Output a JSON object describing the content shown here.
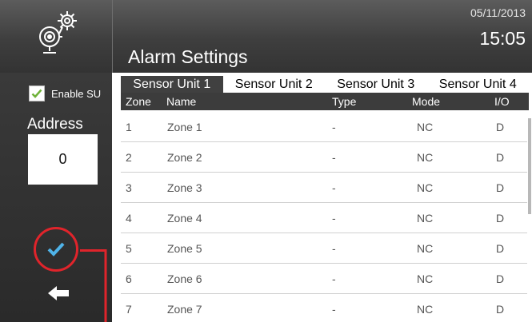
{
  "header": {
    "title": "Alarm Settings",
    "date": "05/11/2013",
    "time": "15:05",
    "logo_icon": "alarm-bell-gear-icon"
  },
  "sidebar": {
    "enable_label": "Enable SU",
    "enable_checked": true,
    "address_label": "Address",
    "address_value": "0",
    "confirm_icon": "checkmark-icon",
    "back_icon": "arrow-left-icon"
  },
  "tabs": [
    {
      "label": "Sensor Unit 1",
      "active": true
    },
    {
      "label": "Sensor Unit 2",
      "active": false
    },
    {
      "label": "Sensor Unit 3",
      "active": false
    },
    {
      "label": "Sensor Unit 4",
      "active": false
    }
  ],
  "table": {
    "columns": {
      "zone": "Zone",
      "name": "Name",
      "type": "Type",
      "mode": "Mode",
      "io": "I/O"
    },
    "rows": [
      {
        "zone": "1",
        "name": "Zone 1",
        "type": "-",
        "mode": "NC",
        "io": "D"
      },
      {
        "zone": "2",
        "name": "Zone 2",
        "type": "-",
        "mode": "NC",
        "io": "D"
      },
      {
        "zone": "3",
        "name": "Zone 3",
        "type": "-",
        "mode": "NC",
        "io": "D"
      },
      {
        "zone": "4",
        "name": "Zone 4",
        "type": "-",
        "mode": "NC",
        "io": "D"
      },
      {
        "zone": "5",
        "name": "Zone 5",
        "type": "-",
        "mode": "NC",
        "io": "D"
      },
      {
        "zone": "6",
        "name": "Zone 6",
        "type": "-",
        "mode": "NC",
        "io": "D"
      },
      {
        "zone": "7",
        "name": "Zone 7",
        "type": "-",
        "mode": "NC",
        "io": "D"
      }
    ]
  },
  "colors": {
    "accent_check": "#4fb3e8",
    "highlight": "#e0242b",
    "header_bg": "#444444",
    "sidebar_bg": "#2f2f2f"
  }
}
